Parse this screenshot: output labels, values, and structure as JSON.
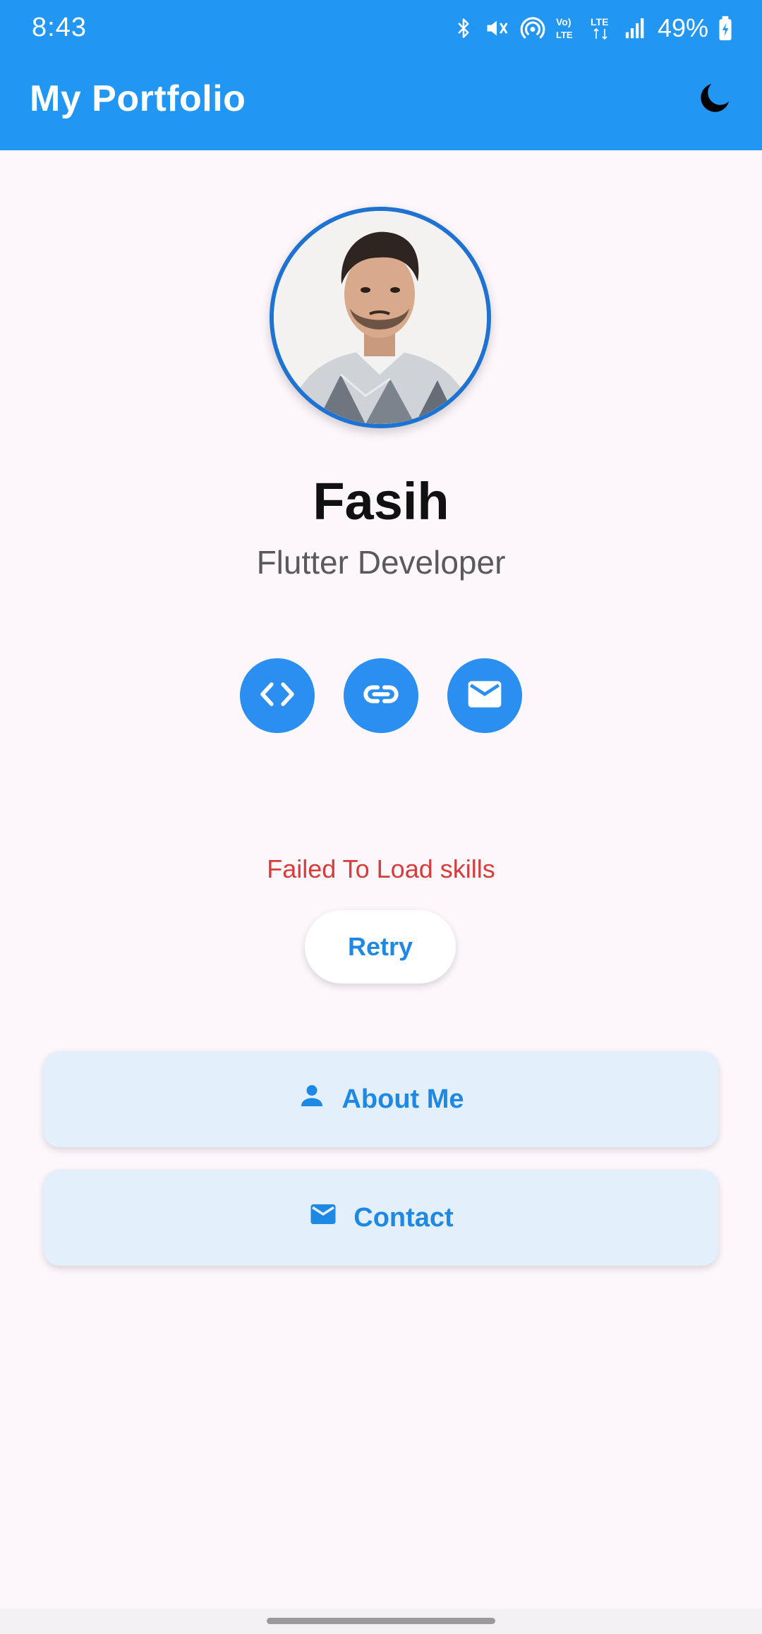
{
  "status_bar": {
    "time": "8:43",
    "battery": "49%"
  },
  "app_bar": {
    "title": "My Portfolio"
  },
  "profile": {
    "name": "Fasih",
    "role": "Flutter Developer"
  },
  "social_links": [
    {
      "icon": "code-icon"
    },
    {
      "icon": "link-icon"
    },
    {
      "icon": "mail-icon"
    }
  ],
  "skills": {
    "error_message": "Failed To Load skills",
    "retry_label": "Retry"
  },
  "nav_buttons": {
    "about_label": "About Me",
    "contact_label": "Contact"
  },
  "colors": {
    "primary": "#2196f3",
    "background": "#fdf7fc",
    "error": "#d63c3c",
    "button_tint": "#e3f0fc"
  }
}
